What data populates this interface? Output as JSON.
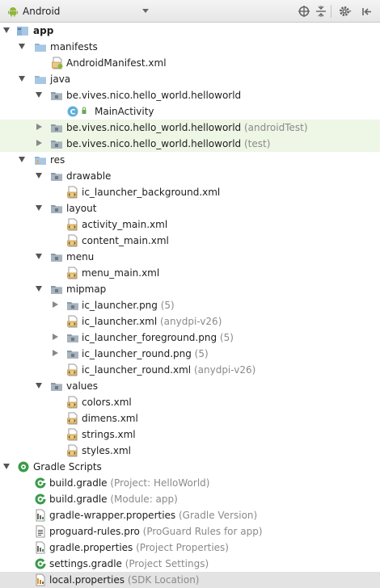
{
  "toolbar": {
    "view_title": "Android",
    "icons": [
      "android-icon",
      "dropdown-caret-icon",
      "locate-target-icon",
      "collapse-all-icon",
      "settings-gear-icon",
      "hide-panel-icon"
    ]
  },
  "tree": {
    "app": "app",
    "manifests": "manifests",
    "android_manifest": "AndroidManifest.xml",
    "java": "java",
    "pkg_main": "be.vives.nico.hello_world.helloworld",
    "main_activity": "MainActivity",
    "pkg_android_test": "be.vives.nico.hello_world.helloworld",
    "pkg_android_test_hint": " (androidTest)",
    "pkg_test": "be.vives.nico.hello_world.helloworld",
    "pkg_test_hint": " (test)",
    "res": "res",
    "drawable": "drawable",
    "ic_launcher_background": "ic_launcher_background.xml",
    "layout": "layout",
    "activity_main": "activity_main.xml",
    "content_main": "content_main.xml",
    "menu": "menu",
    "menu_main": "menu_main.xml",
    "mipmap": "mipmap",
    "ic_launcher_png": "ic_launcher.png",
    "ic_launcher_png_hint": " (5)",
    "ic_launcher_xml": "ic_launcher.xml",
    "ic_launcher_xml_hint": " (anydpi-v26)",
    "ic_launcher_foreground": "ic_launcher_foreground.png",
    "ic_launcher_foreground_hint": " (5)",
    "ic_launcher_round_png": "ic_launcher_round.png",
    "ic_launcher_round_png_hint": " (5)",
    "ic_launcher_round_xml": "ic_launcher_round.xml",
    "ic_launcher_round_xml_hint": " (anydpi-v26)",
    "values": "values",
    "colors": "colors.xml",
    "dimens": "dimens.xml",
    "strings": "strings.xml",
    "styles": "styles.xml",
    "gradle_scripts": "Gradle Scripts",
    "build_gradle_project": "build.gradle",
    "build_gradle_project_hint": " (Project: HelloWorld)",
    "build_gradle_module": "build.gradle",
    "build_gradle_module_hint": " (Module: app)",
    "gradle_wrapper": "gradle-wrapper.properties",
    "gradle_wrapper_hint": " (Gradle Version)",
    "proguard": "proguard-rules.pro",
    "proguard_hint": " (ProGuard Rules for app)",
    "gradle_properties": "gradle.properties",
    "gradle_properties_hint": " (Project Properties)",
    "settings_gradle": "settings.gradle",
    "settings_gradle_hint": " (Project Settings)",
    "local_properties": "local.properties",
    "local_properties_hint": " (SDK Location)"
  },
  "colors": {
    "folder_blue": "#8fb4d6",
    "android_green": "#8fb63b",
    "gradle_green": "#3a9a4a",
    "class_badge": "#5fb0d8",
    "highlight_row": "#eef6e6",
    "selected_row": "#e3e3e3"
  }
}
